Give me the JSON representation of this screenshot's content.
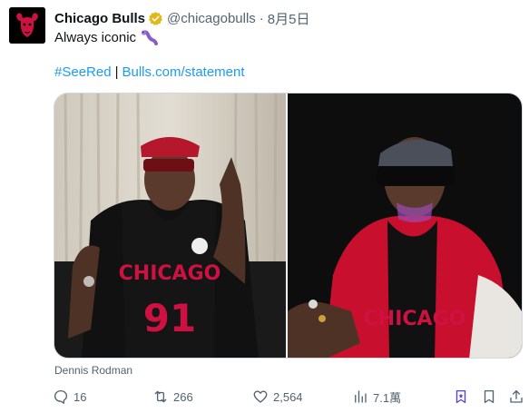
{
  "account": {
    "display_name": "Chicago Bulls",
    "handle": "@chicagobulls",
    "separator": "·",
    "date": "8月5日",
    "avatar_icon": "bulls-logo-icon",
    "verified_icon": "verified-gold-badge-icon"
  },
  "tweet": {
    "text": "Always iconic",
    "emoji_icon": "worm-emoji-icon",
    "hashtag": "#SeeRed",
    "link_separator": "|",
    "link": "Bulls.com/statement"
  },
  "media": {
    "caption": "Dennis Rodman",
    "images": [
      "photo-left",
      "photo-right"
    ],
    "jersey_text": "CHICAGO",
    "jersey_number": "91"
  },
  "actions": {
    "replies": "16",
    "reposts": "266",
    "likes": "2,564",
    "views": "7.1萬"
  },
  "colors": {
    "link": "#1d9bf0",
    "secondary_text": "#536471",
    "brand_red": "#ce1141",
    "verified_gold": "#e2b719"
  }
}
